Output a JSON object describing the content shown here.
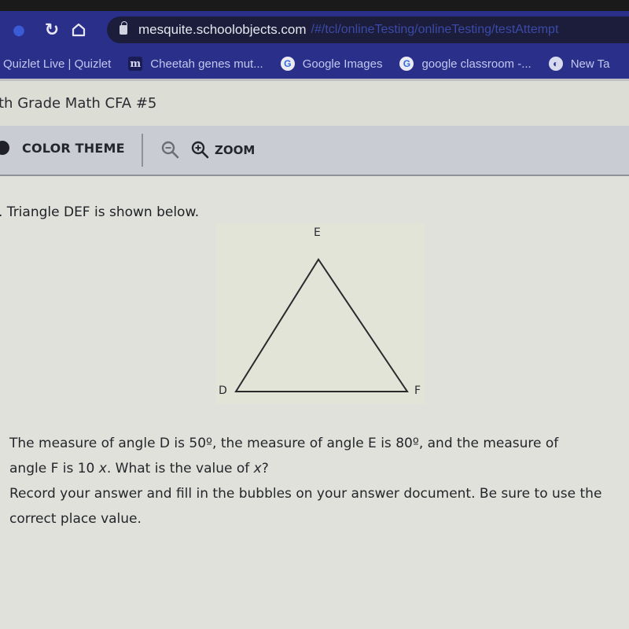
{
  "browser": {
    "url_host": "mesquite.schoolobjects.com",
    "url_path": "/#/tcl/onlineTesting/onlineTesting/testAttempt",
    "nav_icons": [
      "back-icon",
      "reload-icon",
      "home-icon",
      "lock-icon"
    ],
    "bookmarks": [
      {
        "label": "Quizlet Live | Quizlet",
        "icon": "none"
      },
      {
        "label": "Cheetah genes mut...",
        "icon": "m-icon"
      },
      {
        "label": "Google Images",
        "icon": "google-icon"
      },
      {
        "label": "google classroom -...",
        "icon": "google-icon"
      },
      {
        "label": "New Ta",
        "icon": "globe-icon"
      }
    ],
    "accent_color": "#2a2f8a"
  },
  "app": {
    "title": "th Grade Math CFA #5"
  },
  "toolbar": {
    "color_theme_label": "COLOR THEME",
    "zoom_label": "ZOOM"
  },
  "question": {
    "intro": ". Triangle DEF is shown below.",
    "vertices": {
      "top": "E",
      "left": "D",
      "right": "F"
    },
    "line1_a": "The measure of angle D is 50º, the measure of angle E is 80º, and the measure of",
    "line2_a": "angle F is 10 ",
    "var_x": "x",
    "line2_b": ". What is the value of ",
    "line2_c": "?",
    "instructions": "Record your answer and fill in the bubbles on your answer document. Be sure to use the correct place value."
  }
}
